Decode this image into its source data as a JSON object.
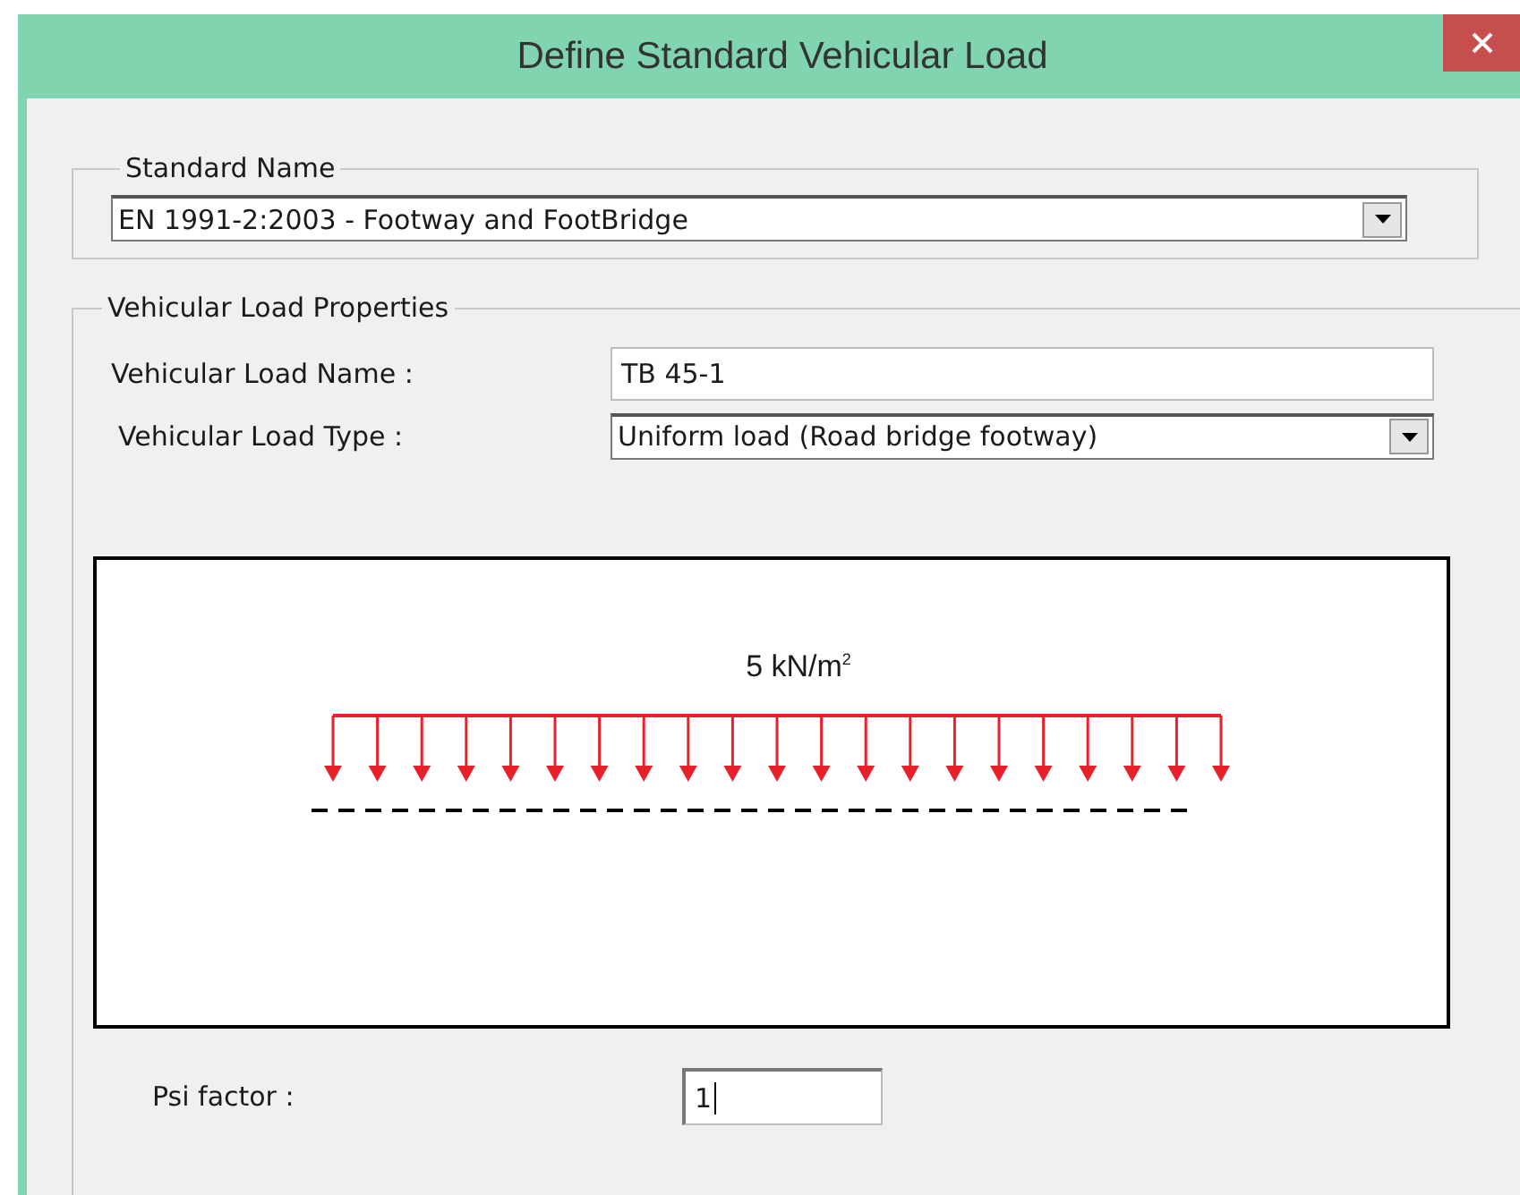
{
  "window": {
    "title": "Define Standard Vehicular Load"
  },
  "standard_name": {
    "legend": "Standard Name",
    "value": "EN 1991-2:2003 - Footway and FootBridge"
  },
  "properties": {
    "legend": "Vehicular Load Properties",
    "fields": [
      {
        "kind": "text",
        "label": "Vehicular Load Name :",
        "value": "TB 45-1"
      },
      {
        "kind": "dropdown",
        "label": "Vehicular Load Type :",
        "value": "Uniform load (Road bridge footway)"
      }
    ],
    "diagram": {
      "load_label": "5 kN/m$^{2}$"
    },
    "psi": {
      "label": "Psi factor :",
      "value": "1"
    }
  }
}
